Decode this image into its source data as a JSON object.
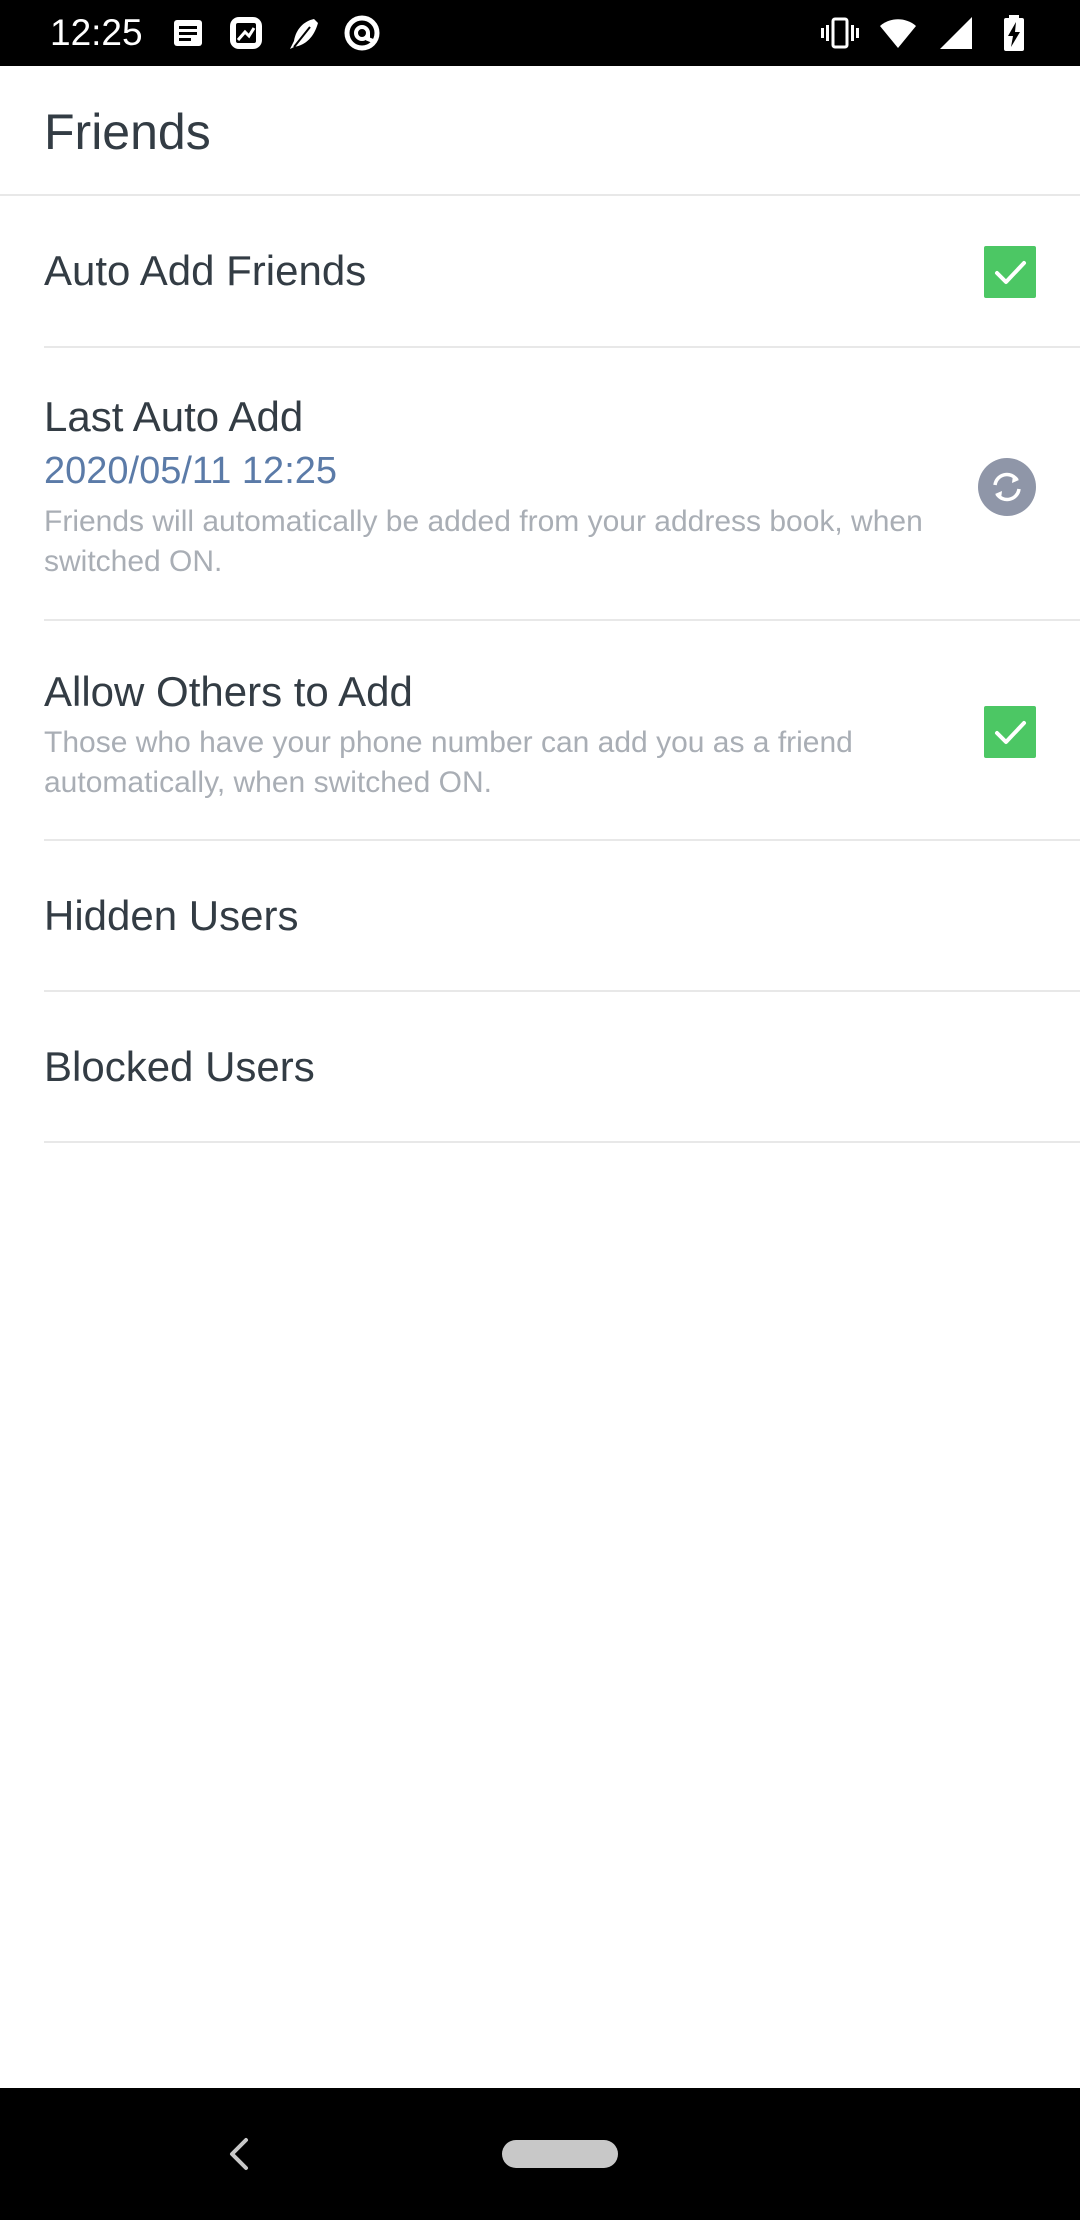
{
  "status_bar": {
    "time": "12:25",
    "left_icons": [
      "message-icon",
      "image-icon",
      "feather-icon",
      "at-sign-icon"
    ],
    "right_icons": [
      "vibrate-icon",
      "wifi-icon",
      "signal-icon",
      "battery-charging-icon"
    ]
  },
  "header": {
    "title": "Friends"
  },
  "settings": {
    "auto_add": {
      "label": "Auto Add Friends",
      "checked": true
    },
    "last_auto_add": {
      "label": "Last Auto Add",
      "date": "2020/05/11 12:25",
      "description": "Friends will automatically be added from your address book, when switched ON."
    },
    "allow_others": {
      "label": "Allow Others to Add",
      "description": "Those who have your phone number can add you as a friend automatically, when switched ON.",
      "checked": true
    },
    "hidden_users": {
      "label": "Hidden Users"
    },
    "blocked_users": {
      "label": "Blocked Users"
    }
  },
  "colors": {
    "accent_green": "#4cc764",
    "date_blue": "#5b7ba8",
    "refresh_gray": "#8f96a8"
  }
}
